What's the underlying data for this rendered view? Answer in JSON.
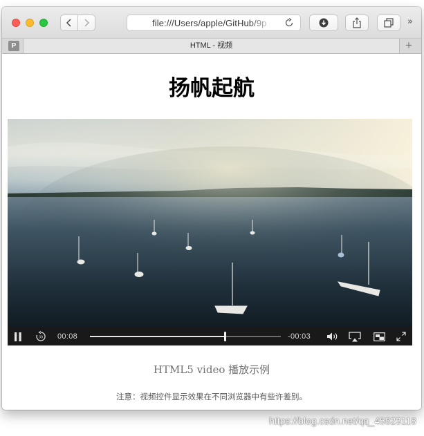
{
  "browser": {
    "url": "file:///Users/apple/GitHub/9p",
    "tab_title": "HTML - 视频",
    "pinned_tab_letter": "P",
    "overflow_label": "»",
    "new_tab_label": "+"
  },
  "page": {
    "heading": "扬帆起航",
    "caption": "HTML5 video 播放示例",
    "note": "注意：视频控件显示效果在不同浏览器中有些许差别。"
  },
  "video": {
    "current_time": "00:08",
    "remaining_time": "-00:03",
    "progress": 0.71,
    "state": "playing"
  },
  "watermark": "https://blog.csdn.net/qq_45823118",
  "colors": {
    "close": "#fc5f57",
    "minimize": "#fdbc2e",
    "maximize": "#28c840",
    "control_bar": "#1c1c1e"
  },
  "icons": {
    "back": "chevron-left-icon",
    "forward": "chevron-right-icon",
    "reload": "reload-icon",
    "download": "download-icon",
    "share": "share-icon",
    "tabs": "tabs-overview-icon",
    "pause": "pause-icon",
    "skip_back": "skip-back-30-icon",
    "volume": "volume-icon",
    "airplay": "airplay-icon",
    "pip": "picture-in-picture-icon",
    "fullscreen": "fullscreen-icon"
  }
}
